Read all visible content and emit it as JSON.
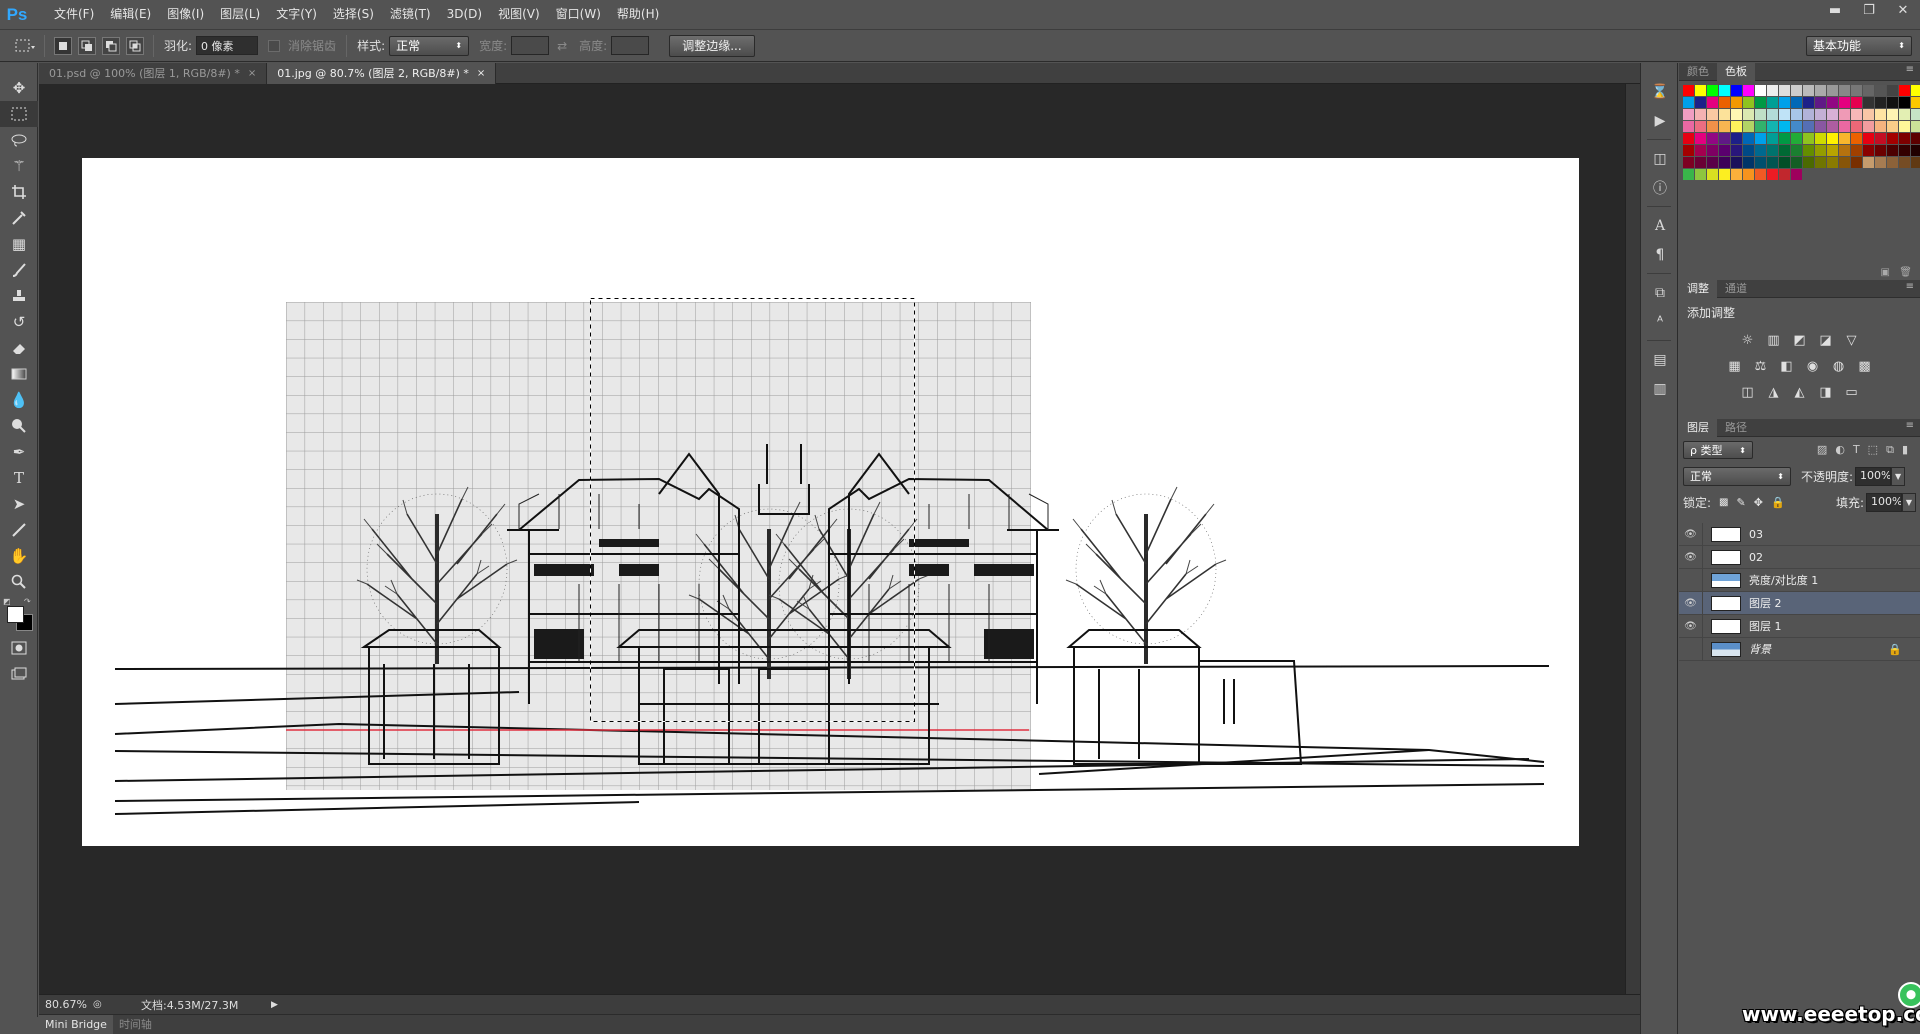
{
  "app": {
    "logo": "Ps"
  },
  "menu": [
    "文件(F)",
    "编辑(E)",
    "图像(I)",
    "图层(L)",
    "文字(Y)",
    "选择(S)",
    "滤镜(T)",
    "3D(D)",
    "视图(V)",
    "窗口(W)",
    "帮助(H)"
  ],
  "window_controls": {
    "minimize": "▬",
    "restore": "❐",
    "close": "✕"
  },
  "options": {
    "feather_label": "羽化:",
    "feather_value": "0 像素",
    "antialias_label": "消除锯齿",
    "style_label": "样式:",
    "style_value": "正常",
    "width_label": "宽度:",
    "height_label": "高度:",
    "refine_edge": "调整边缘...",
    "workspace": "基本功能"
  },
  "tabs": [
    {
      "label": "01.psd @ 100% (图层 1, RGB/8#) *",
      "close": "×"
    },
    {
      "label": "01.jpg @ 80.7% (图层 2, RGB/8#) *",
      "close": "×"
    }
  ],
  "status": {
    "zoom": "80.67%",
    "doc": "文档:4.53M/27.3M"
  },
  "bottom_tabs": [
    "Mini Bridge",
    "时间轴"
  ],
  "swatch_panel": {
    "tabs": [
      "颜色",
      "色板"
    ]
  },
  "swatch_colors": [
    "#ff0000",
    "#ffff00",
    "#00ff00",
    "#00ffff",
    "#0000ff",
    "#ff00ff",
    "#ffffff",
    "#eeeeee",
    "#dddddd",
    "#cccccc",
    "#bbbbbb",
    "#aaaaaa",
    "#999999",
    "#888888",
    "#777777",
    "#666666",
    "#555555",
    "#444444",
    "#ff0000",
    "#ffff00",
    "#00a0e9",
    "#1d2088",
    "#e4007f",
    "#eb6100",
    "#f39800",
    "#8fc31f",
    "#009944",
    "#009e96",
    "#00a0e9",
    "#0068b7",
    "#1d2088",
    "#601986",
    "#920783",
    "#e4007f",
    "#e5004f",
    "#333333",
    "#222222",
    "#111111",
    "#000000",
    "#fcc800",
    "#f19ec2",
    "#f5b2b2",
    "#fac9a2",
    "#fce29a",
    "#fff8b3",
    "#dbe9b1",
    "#bfe0c6",
    "#b3dcd8",
    "#bfe3f7",
    "#a7c6e9",
    "#b2b3d9",
    "#c4b0d6",
    "#d7b0d6",
    "#ef9ab6",
    "#f7b8b8",
    "#f8c6a6",
    "#ffe3a3",
    "#fff3b3",
    "#e3efb3",
    "#c6e4c6",
    "#ea68a2",
    "#ec6d81",
    "#f19149",
    "#f8b551",
    "#fff45c",
    "#b3d465",
    "#32b16c",
    "#13b5b1",
    "#00b7ee",
    "#448aca",
    "#556fb5",
    "#8957a1",
    "#ae5da1",
    "#ea68a2",
    "#eb6877",
    "#f29c9f",
    "#f6b37f",
    "#facd89",
    "#fff799",
    "#cce198",
    "#e60012",
    "#e4007f",
    "#920783",
    "#601986",
    "#1d2088",
    "#0068b7",
    "#00a0e9",
    "#009e96",
    "#009944",
    "#22ac38",
    "#8fc31f",
    "#cfdb00",
    "#fff100",
    "#f8b62d",
    "#eb6100",
    "#e60012",
    "#c30d23",
    "#a40000",
    "#7d0000",
    "#5c0000",
    "#a40000",
    "#a4004f",
    "#7e0063",
    "#5a006e",
    "#29167b",
    "#004986",
    "#00698f",
    "#00736d",
    "#006934",
    "#1b7f30",
    "#648e00",
    "#949d00",
    "#b8a400",
    "#b5720f",
    "#a14000",
    "#8a0000",
    "#6b0000",
    "#4c0000",
    "#330000",
    "#200000",
    "#7d0022",
    "#6a0035",
    "#5a0048",
    "#3d0058",
    "#1a0f5b",
    "#003468",
    "#004f6d",
    "#005551",
    "#004f27",
    "#145e24",
    "#4b6a00",
    "#6f7500",
    "#8a7b00",
    "#875508",
    "#792f00",
    "#c69c6d",
    "#a67c52",
    "#8c6239",
    "#754c24",
    "#603913",
    "#39b54a",
    "#8dc63f",
    "#d9e021",
    "#fcee21",
    "#fbb03b",
    "#f7931e",
    "#f15a24",
    "#ed1c24",
    "#c1272d",
    "#9e005d"
  ],
  "adjustments": {
    "tabs": [
      "调整",
      "通道"
    ],
    "title": "添加调整",
    "row1": [
      "☼",
      "▥",
      "◩",
      "◪",
      "▽"
    ],
    "row2": [
      "▦",
      "⚖",
      "◧",
      "◉",
      "◍",
      "▩"
    ],
    "row3": [
      "◫",
      "◮",
      "◭",
      "◨",
      "▭"
    ]
  },
  "layers_panel": {
    "tabs": [
      "图层",
      "路径"
    ],
    "filter": "ρ 类型",
    "blend": "正常",
    "opacity_label": "不透明度:",
    "opacity": "100%",
    "lock_label": "锁定:",
    "fill_label": "填充:",
    "fill": "100%"
  },
  "layers": [
    {
      "name": "03",
      "visible": true,
      "selected": false
    },
    {
      "name": "02",
      "visible": true,
      "selected": false
    },
    {
      "name": "亮度/对比度 1",
      "visible": false,
      "selected": false
    },
    {
      "name": "图层 2",
      "visible": true,
      "selected": true
    },
    {
      "name": "图层 1",
      "visible": true,
      "selected": false
    },
    {
      "name": "背景",
      "visible": false,
      "selected": false,
      "locked": true
    }
  ],
  "watermark": "www.eeeetop.com"
}
